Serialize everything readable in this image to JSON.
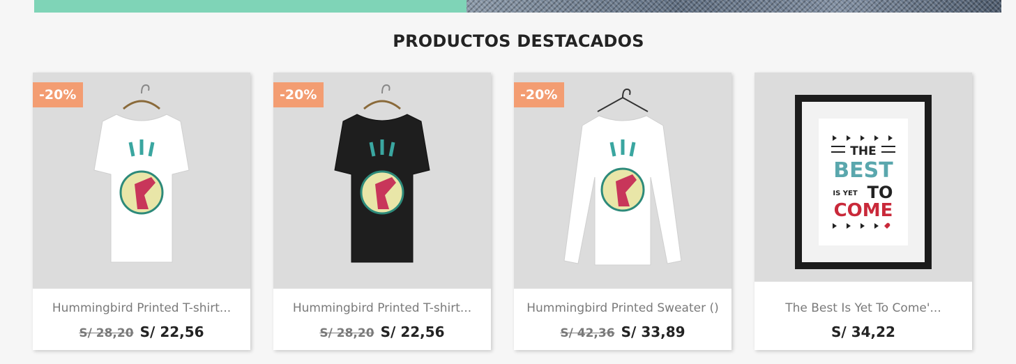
{
  "section": {
    "title": "PRODUCTOS DESTACADOS"
  },
  "products": [
    {
      "name": "Hummingbird Printed T-shirt...",
      "old_price": "S/ 28,20",
      "price": "S/ 22,56",
      "discount": "-20%"
    },
    {
      "name": "Hummingbird Printed T-shirt...",
      "old_price": "S/ 28,20",
      "price": "S/ 22,56",
      "discount": "-20%"
    },
    {
      "name": "Hummingbird Printed Sweater ()",
      "old_price": "S/ 42,36",
      "price": "S/ 33,89",
      "discount": "-20%"
    },
    {
      "name": "The Best Is Yet To Come'...",
      "price": "S/ 34,22"
    }
  ],
  "poster": {
    "line1": "THE",
    "line2": "BEST",
    "line3a": "IS YET",
    "line3b": "TO",
    "line4": "COME"
  },
  "colors": {
    "badge": "#f39d72",
    "banner": "#7fd4b7"
  }
}
